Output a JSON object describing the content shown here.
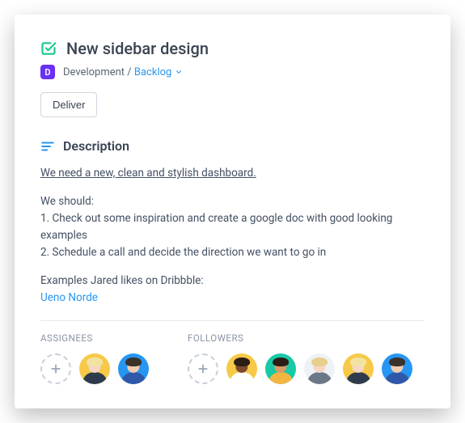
{
  "task": {
    "title": "New sidebar design",
    "project_letter": "D",
    "project_name": "Development",
    "separator": " / ",
    "status": "Backlog",
    "deliver_label": "Deliver"
  },
  "description": {
    "header": "Description",
    "lead": "We need a new, clean and stylish dashboard.",
    "intro": "We should:",
    "step1": "1. Check out some inspiration and create a google doc with good looking examples",
    "step2": "2. Schedule a call and decide the direction we want to go in",
    "examples_label": "Examples Jared likes on Dribbble:",
    "example_link": "Ueno Norde"
  },
  "assignees": {
    "label": "ASSIGNEES",
    "people": [
      {
        "bg": "#f7c948",
        "skin": "#f4d7c6",
        "hair": "#f3e3a3",
        "shirt": "#2e3b4e"
      },
      {
        "bg": "#2796f3",
        "skin": "#f0cdb2",
        "hair": "#3a3128",
        "shirt": "#3058a8"
      }
    ]
  },
  "followers": {
    "label": "FOLLOWERS",
    "people": [
      {
        "bg": "#f7c948",
        "skin": "#7a4a2b",
        "hair": "#2a1d14",
        "shirt": "#ffffff"
      },
      {
        "bg": "#17c9a7",
        "skin": "#d89a6a",
        "hair": "#2a1d14",
        "shirt": "#f4b642"
      },
      {
        "bg": "#eef2f6",
        "skin": "#f4d7c6",
        "hair": "#e8cf8a",
        "shirt": "#6b7785"
      },
      {
        "bg": "#f7c948",
        "skin": "#f4d7c6",
        "hair": "#f3e3a3",
        "shirt": "#2e3b4e"
      },
      {
        "bg": "#2796f3",
        "skin": "#f0cdb2",
        "hair": "#3a3128",
        "shirt": "#3058a8"
      }
    ]
  }
}
